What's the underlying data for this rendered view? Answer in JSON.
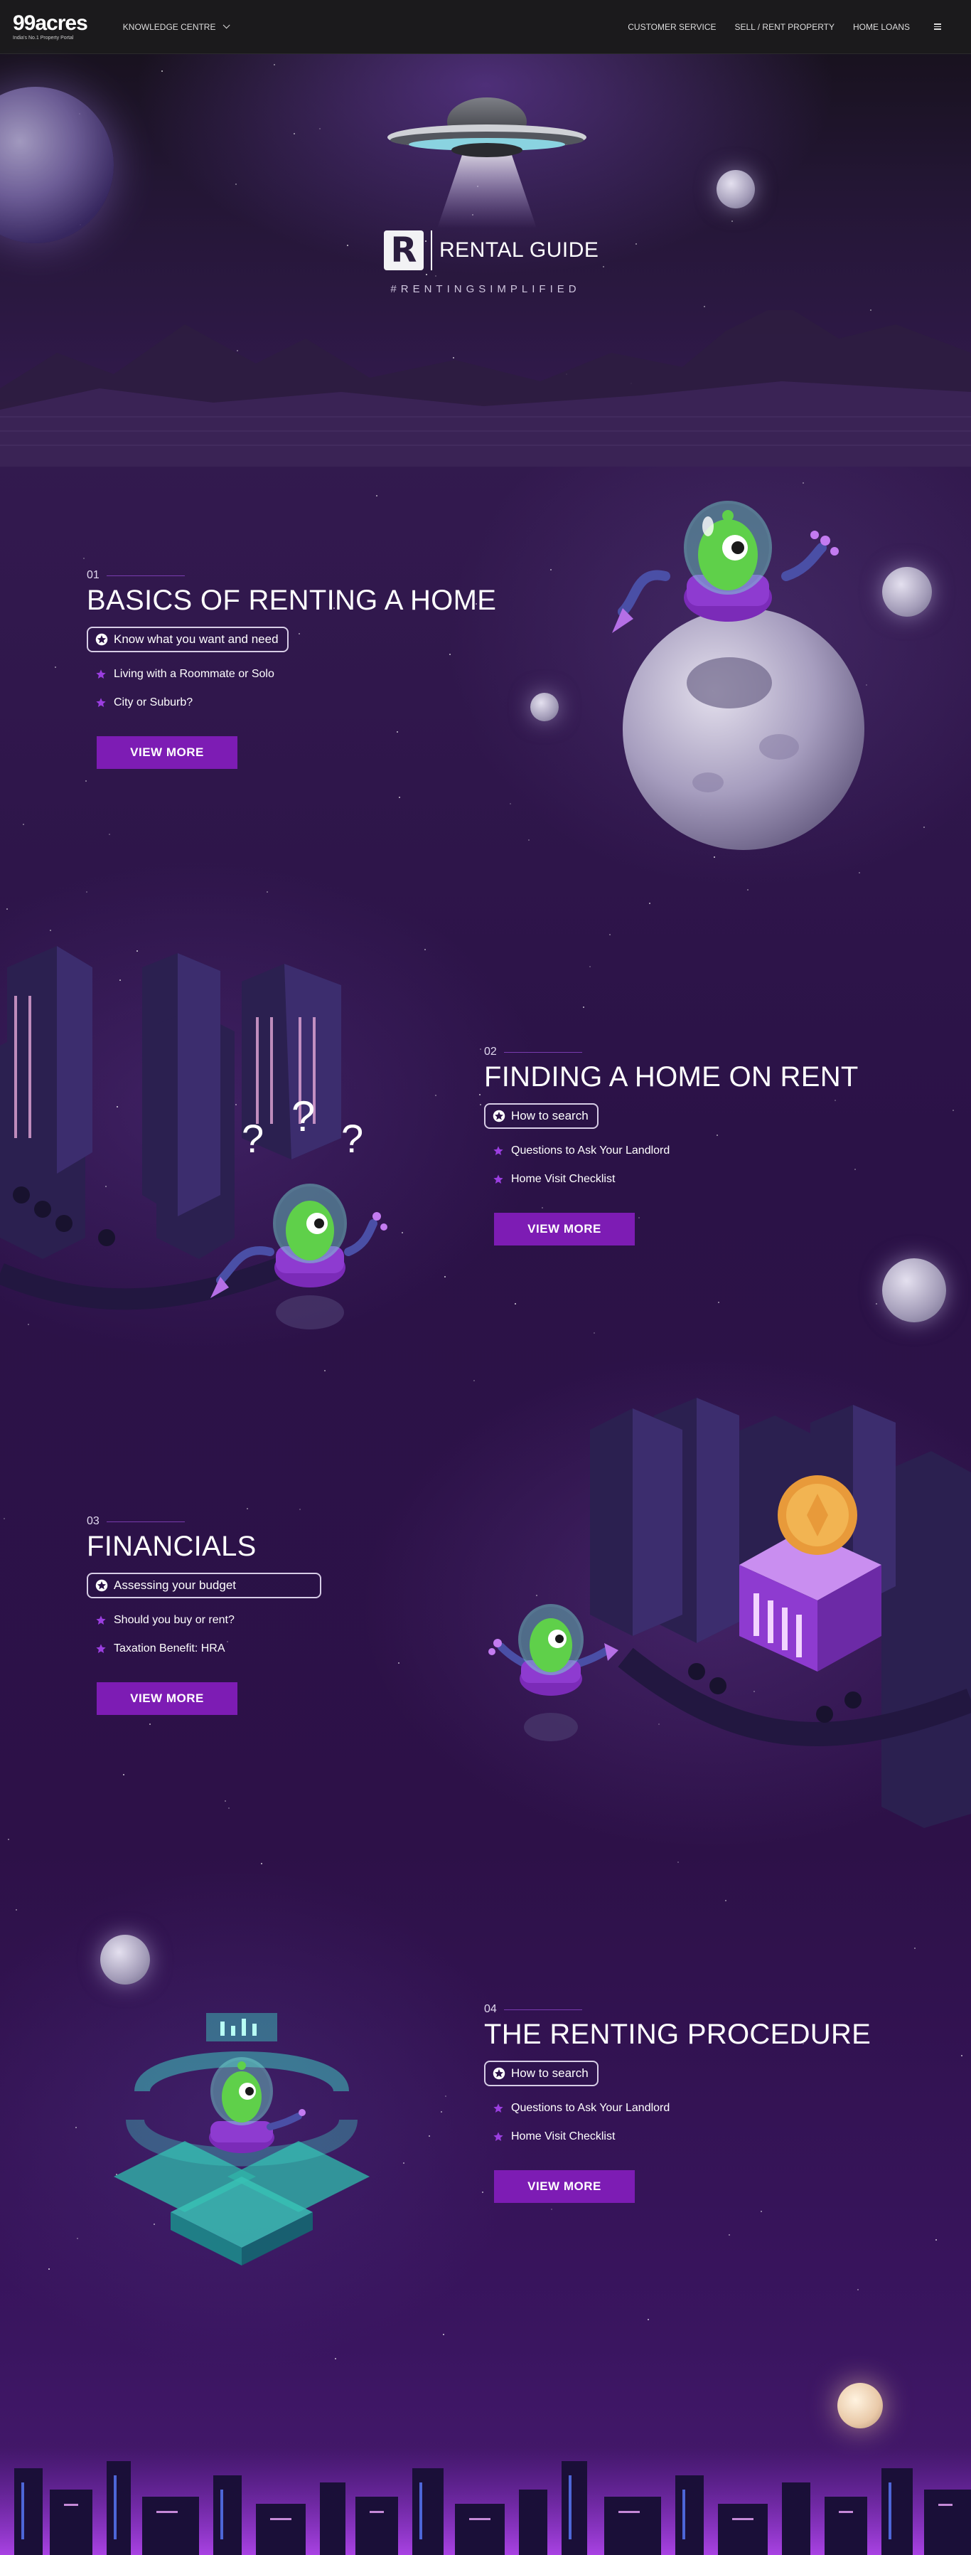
{
  "header": {
    "logo_main": "99acres",
    "logo_sub": "India's No.1 Property Portal",
    "knowledge_centre": "KNOWLEDGE CENTRE",
    "nav": [
      "CUSTOMER SERVICE",
      "SELL / RENT PROPERTY",
      "HOME LOANS"
    ]
  },
  "hero": {
    "logo_letter": "R",
    "title": "RENTAL GUIDE",
    "hashtag": "#RENTINGSIMPLIFIED"
  },
  "sections": [
    {
      "number": "01",
      "title": "BASICS OF RENTING A HOME",
      "pill": "Know what you want and need",
      "bullets": [
        "Living with a Roommate or Solo",
        "City or Suburb?"
      ],
      "button": "VIEW MORE"
    },
    {
      "number": "02",
      "title": "FINDING A HOME ON RENT",
      "pill": "How to search",
      "bullets": [
        "Questions to Ask Your Landlord",
        "Home Visit Checklist"
      ],
      "button": "VIEW MORE"
    },
    {
      "number": "03",
      "title": "FINANCIALS",
      "pill": "Assessing your budget",
      "bullets": [
        "Should you buy or rent?",
        "Taxation Benefit: HRA"
      ],
      "button": "VIEW MORE"
    },
    {
      "number": "04",
      "title": "THE RENTING PROCEDURE",
      "pill": "How to search",
      "bullets": [
        "Questions to Ask Your Landlord",
        "Home Visit Checklist"
      ],
      "button": "VIEW MORE"
    }
  ],
  "illustrations": {
    "question_mark": "?"
  },
  "colors": {
    "accent": "#7d1cb4",
    "header_bg": "#1b1a1c",
    "alien_green": "#5fd04a"
  }
}
